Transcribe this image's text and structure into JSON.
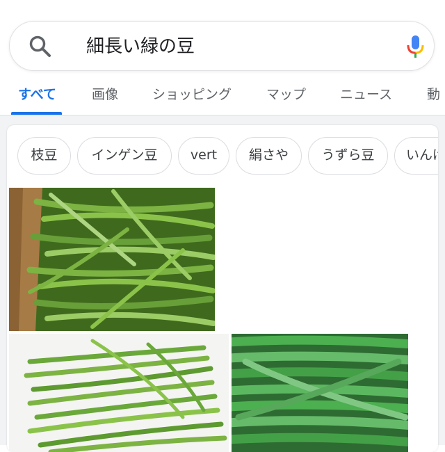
{
  "search": {
    "query": "細長い緑の豆"
  },
  "tabs": [
    {
      "label": "すべて",
      "active": true
    },
    {
      "label": "画像",
      "active": false
    },
    {
      "label": "ショッピング",
      "active": false
    },
    {
      "label": "マップ",
      "active": false
    },
    {
      "label": "ニュース",
      "active": false
    },
    {
      "label": "動",
      "active": false
    }
  ],
  "chips": [
    "枝豆",
    "インゲン豆",
    "vert",
    "絹さや",
    "うずら豆",
    "いんげ"
  ],
  "images": [
    {
      "name": "green-beans-in-box"
    },
    {
      "name": "green-beans-on-white"
    },
    {
      "name": "green-beans-closeup"
    }
  ],
  "colors": {
    "accent": "#1a73e8",
    "tab_inactive": "#5f6368",
    "chip_border": "#dadce0"
  },
  "icons": [
    "search-icon",
    "mic-icon"
  ]
}
